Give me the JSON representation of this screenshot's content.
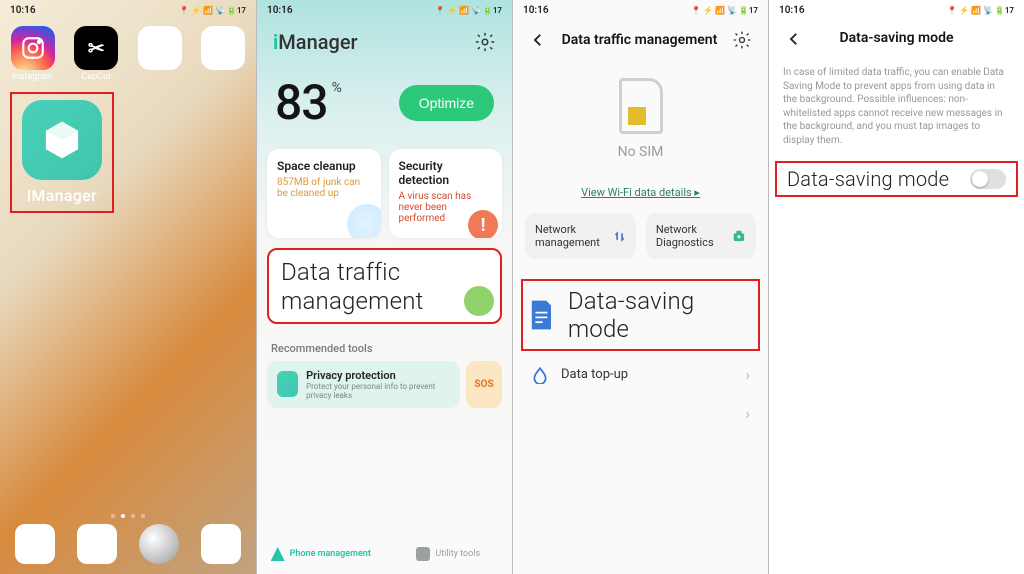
{
  "status": {
    "time": "10:16",
    "right": "📍 ⚡ 📶 📡 🔋17"
  },
  "screen1": {
    "apps": {
      "instagram": "Instagram",
      "capcut": "CapCut"
    },
    "imanager": {
      "label": "iManager"
    }
  },
  "screen2": {
    "brand_i": "i",
    "brand_rest": "Manager",
    "score": "83",
    "score_unit": "%",
    "optimize": "Optimize",
    "card_a": {
      "title": "Space cleanup",
      "desc": "857MB of junk can be cleaned up"
    },
    "card_b": {
      "title": "Security detection",
      "desc": "A virus scan has never been performed"
    },
    "dtm": "Data traffic management",
    "rec_title": "Recommended tools",
    "rec_privacy": {
      "title": "Privacy protection",
      "desc": "Protect your personal info to prevent privacy leaks"
    },
    "rec_sos": "SOS",
    "tab_phone": "Phone management",
    "tab_util": "Utility tools"
  },
  "screen3": {
    "title": "Data traffic management",
    "nosim": "No SIM",
    "wifi_link": "View Wi-Fi data details ▸",
    "net_mgmt": "Network management",
    "net_diag": "Network Diagnostics",
    "dsm": "Data-saving mode",
    "topup": "Data top-up"
  },
  "screen4": {
    "title": "Data-saving mode",
    "info": "In case of limited data traffic, you can enable Data Saving Mode to prevent apps from using data in the background.\nPossible influences: non-whitelisted apps cannot receive new messages in the background, and you must tap images to display them.",
    "toggle_label": "Data-saving mode",
    "toggle_state": "off"
  }
}
